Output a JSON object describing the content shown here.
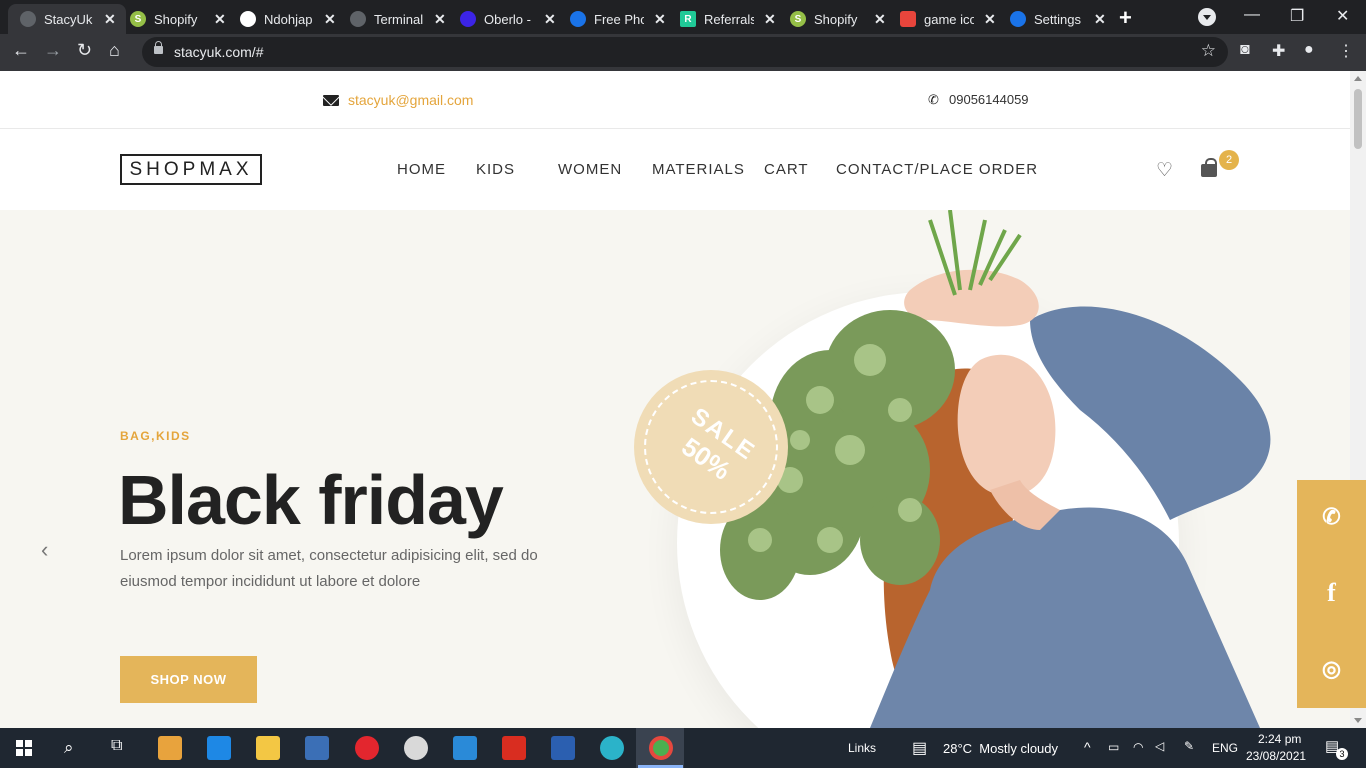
{
  "browser": {
    "tabs": [
      {
        "title": "StacyUk",
        "favicon_color": "#5f6368",
        "favicon_glyph": "",
        "active": true
      },
      {
        "title": "Shopify",
        "favicon_color": "#95bf47",
        "favicon_glyph": "S",
        "active": false
      },
      {
        "title": "Ndohjap",
        "favicon_color": "#ffffff",
        "favicon_glyph": "",
        "active": false
      },
      {
        "title": "Terminal",
        "favicon_color": "#5f6368",
        "favicon_glyph": "",
        "active": false
      },
      {
        "title": "Oberlo -",
        "favicon_color": "#3c24e6",
        "favicon_glyph": "",
        "active": false
      },
      {
        "title": "Free Pho",
        "favicon_color": "#1a73e8",
        "favicon_glyph": "",
        "active": false
      },
      {
        "title": "Referrals",
        "favicon_color": "#20c997",
        "favicon_glyph": "R",
        "active": false
      },
      {
        "title": "Shopify",
        "favicon_color": "#95bf47",
        "favicon_glyph": "S",
        "active": false
      },
      {
        "title": "game ico",
        "favicon_color": "#e8453c",
        "favicon_glyph": "",
        "active": false
      },
      {
        "title": "Settings",
        "favicon_color": "#1a73e8",
        "favicon_glyph": "",
        "active": false
      }
    ],
    "url": "stacyuk.com/#"
  },
  "site": {
    "email": "stacyuk@gmail.com",
    "phone": "09056144059",
    "logo": "SHOPMAX",
    "menu": [
      "HOME",
      "KIDS",
      "WOMEN",
      "MATERIALS",
      "CART",
      "CONTACT/PLACE ORDER"
    ],
    "cart_count": "2",
    "hero": {
      "kicker": "BAG,KIDS",
      "headline": "Black friday",
      "description": "Lorem ipsum dolor sit amet, consectetur adipisicing elit, sed do eiusmod tempor incididunt ut labore et dolore",
      "button": "SHOP NOW",
      "sale_word": "SALE",
      "sale_percent": "50%"
    },
    "social": [
      "whatsapp-icon",
      "facebook-icon",
      "instagram-icon"
    ]
  },
  "taskbar": {
    "links": "Links",
    "weather": "28°C  Mostly cloudy",
    "lang": "ENG",
    "time": "2:24 pm",
    "date": "23/08/2021",
    "notifications": "3"
  },
  "colors": {
    "accent": "#e4b55a",
    "hero_bg": "#f7f6f1"
  }
}
